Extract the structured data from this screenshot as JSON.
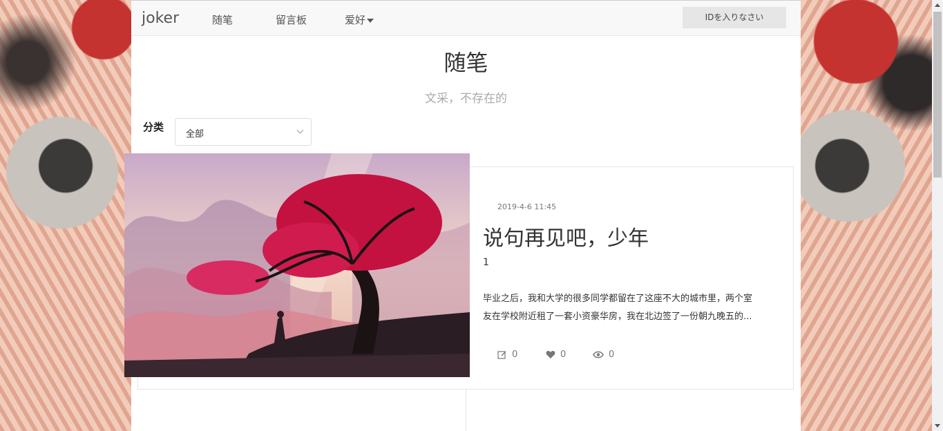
{
  "navbar": {
    "brand": "joker",
    "items": [
      "随笔",
      "留言板"
    ],
    "dropdown_label": "爱好",
    "id_button": "IDを入りなさい"
  },
  "page": {
    "title": "随笔",
    "subtitle": "文采，不存在的"
  },
  "filter": {
    "label": "分类",
    "selected": "全部"
  },
  "post": {
    "date": "2019-4-6 11:45",
    "title": "说句再见吧，少年",
    "number": "1",
    "excerpt_line1": "毕业之后，我和大学的很多同学都留在了这座不大的城市里，两个室",
    "excerpt_line2": "友在学校附近租了一套小资豪华房，我在北边签了一份朝九晚五的...",
    "comments": "0",
    "likes": "0",
    "views": "0"
  }
}
